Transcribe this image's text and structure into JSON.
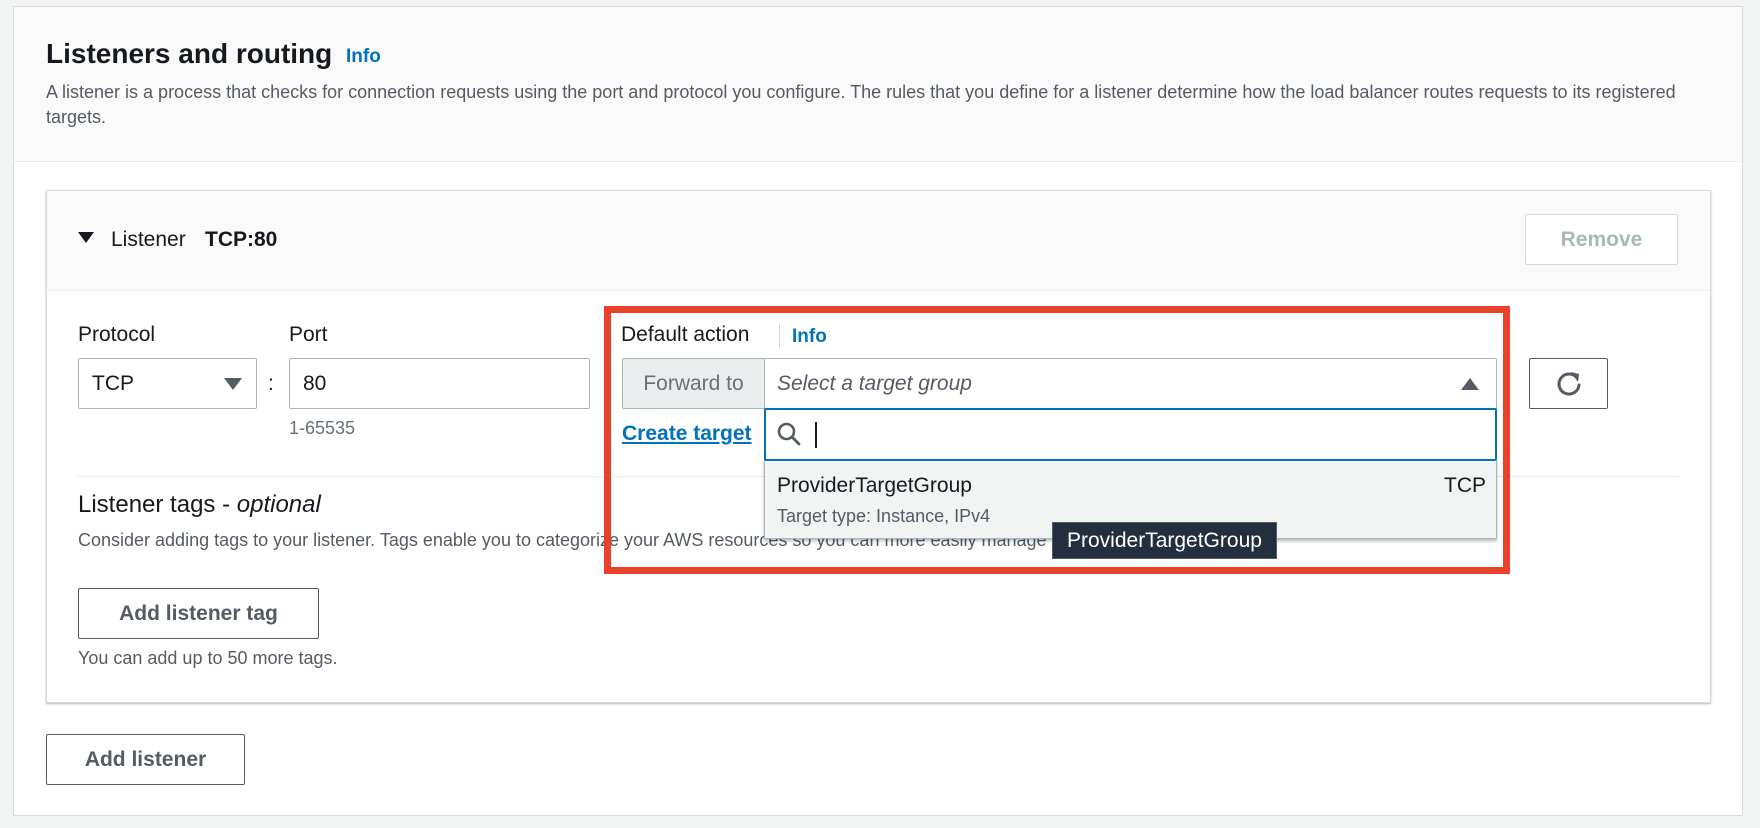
{
  "section": {
    "title": "Listeners and routing",
    "info_link": "Info",
    "description": "A listener is a process that checks for connection requests using the port and protocol you configure. The rules that you define for a listener determine how the load balancer routes requests to its registered targets."
  },
  "listener": {
    "label": "Listener",
    "value": "TCP:80",
    "remove_button": "Remove",
    "protocol_label": "Protocol",
    "protocol_value": "TCP",
    "separator": ":",
    "port_label": "Port",
    "port_value": "80",
    "port_hint": "1-65535",
    "default_action": {
      "label": "Default action",
      "info_link": "Info",
      "forward_to": "Forward to",
      "target_group_placeholder": "Select a target group",
      "search_value": "",
      "create_target_link": "Create target",
      "options": [
        {
          "name": "ProviderTargetGroup",
          "protocol": "TCP",
          "detail": "Target type: Instance, IPv4"
        }
      ],
      "tooltip": "ProviderTargetGroup"
    },
    "tags": {
      "title_prefix": "Listener tags - ",
      "title_optional": "optional",
      "description": "Consider adding tags to your listener. Tags enable you to categorize your AWS resources so you can more easily manage them.",
      "add_button": "Add listener tag",
      "hint": "You can add up to 50 more tags."
    }
  },
  "add_listener_button": "Add listener",
  "colors": {
    "link": "#0073bb",
    "highlight": "#e8412c",
    "tooltip_bg": "#232f3e"
  },
  "icons": [
    "caret-down-icon",
    "select-caret-icon",
    "caret-up-icon",
    "search-icon",
    "refresh-icon"
  ]
}
